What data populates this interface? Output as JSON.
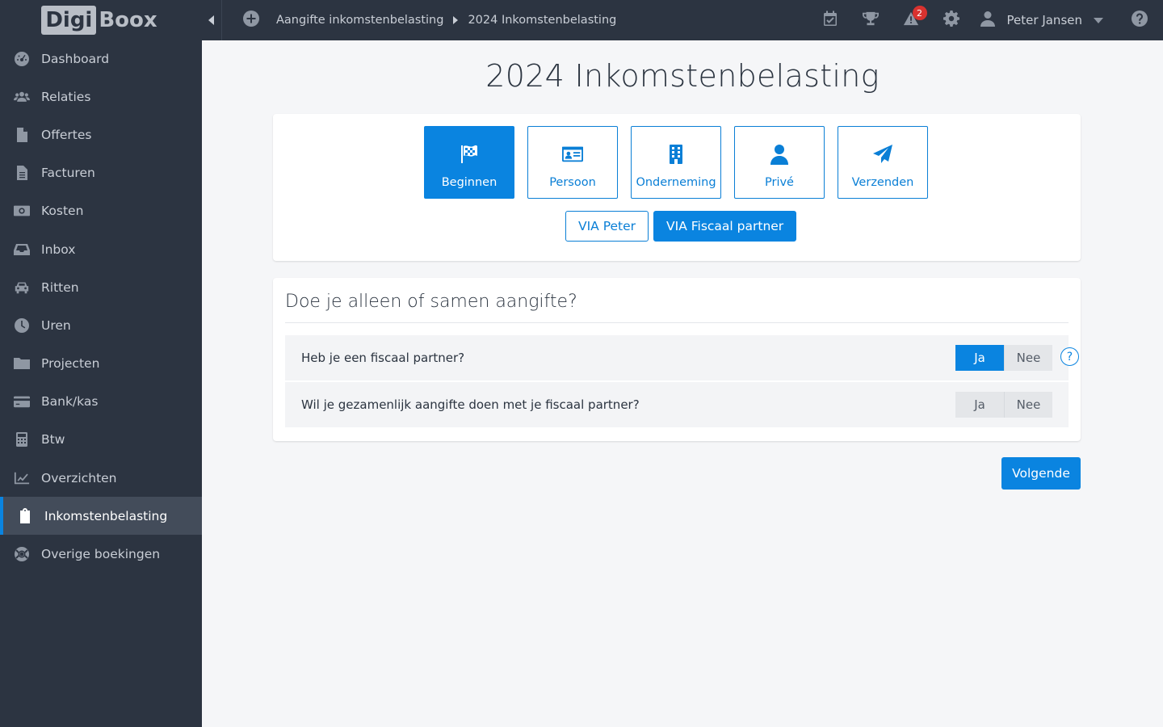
{
  "logo": {
    "part1": "Digi",
    "part2": "Boox"
  },
  "sidebar": {
    "items": [
      {
        "label": "Dashboard",
        "icon": "dashboard-icon"
      },
      {
        "label": "Relaties",
        "icon": "users-icon"
      },
      {
        "label": "Offertes",
        "icon": "file-icon"
      },
      {
        "label": "Facturen",
        "icon": "invoice-icon"
      },
      {
        "label": "Kosten",
        "icon": "money-icon"
      },
      {
        "label": "Inbox",
        "icon": "inbox-icon"
      },
      {
        "label": "Ritten",
        "icon": "car-icon"
      },
      {
        "label": "Uren",
        "icon": "clock-icon"
      },
      {
        "label": "Projecten",
        "icon": "folder-icon"
      },
      {
        "label": "Bank/kas",
        "icon": "credit-card-icon"
      },
      {
        "label": "Btw",
        "icon": "calculator-icon"
      },
      {
        "label": "Overzichten",
        "icon": "chart-line-icon"
      },
      {
        "label": "Inkomstenbelasting",
        "icon": "clipboard-icon",
        "active": true
      },
      {
        "label": "Overige boekingen",
        "icon": "life-ring-icon"
      }
    ]
  },
  "topbar": {
    "breadcrumb": [
      "Aangifte inkomstenbelasting",
      "2024 Inkomstenbelasting"
    ],
    "notifications_count": "2",
    "user_name": "Peter Jansen"
  },
  "page": {
    "title": "2024 Inkomstenbelasting",
    "steps": [
      {
        "label": "Beginnen",
        "icon": "checkered-flag-icon",
        "active": true
      },
      {
        "label": "Persoon",
        "icon": "id-card-icon"
      },
      {
        "label": "Onderneming",
        "icon": "building-icon"
      },
      {
        "label": "Privé",
        "icon": "user-icon"
      },
      {
        "label": "Verzenden",
        "icon": "paper-plane-icon"
      }
    ],
    "via": [
      "VIA Peter",
      "VIA Fiscaal partner"
    ],
    "via_selected": "VIA Fiscaal partner",
    "question_title": "Doe je alleen of samen aangifte?",
    "questions": [
      {
        "text": "Heb je een fiscaal partner?",
        "yes": "Ja",
        "no": "Nee",
        "selected": "Ja",
        "help": "?"
      },
      {
        "text": "Wil je gezamenlijk aangifte doen met je fiscaal partner?",
        "yes": "Ja",
        "no": "Nee",
        "selected": null
      }
    ],
    "next_label": "Volgende"
  },
  "colors": {
    "accent": "#0a84e0",
    "sidebar_bg": "#2c3441",
    "page_bg": "#f5f6f8",
    "badge": "#d9322f"
  }
}
